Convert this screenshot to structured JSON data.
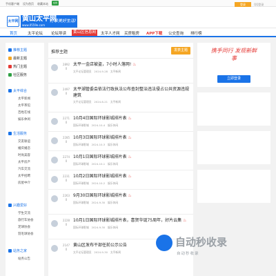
{
  "topbar": {
    "links": [
      "手机客户端",
      "设为首页",
      "收藏本站"
    ],
    "badge": "在线",
    "right": [
      "注册",
      "登录"
    ]
  },
  "header": {
    "logo_text": "太平网",
    "brand_title": "黄山太平网",
    "brand_url": "www.0559e.com",
    "slogan": "分享美好生活!",
    "login_button": "登录",
    "login_hint": "QQ登录"
  },
  "nav": {
    "items": [
      "首页",
      "太平论坛",
      "论坛导读",
      "黄山区信息网",
      "太平人才网",
      "买房租房",
      "APP下载",
      "公交查询",
      "排行榜"
    ]
  },
  "sidebar": {
    "top_items": [
      "推荐主题",
      "最新主题",
      "热门主题",
      "社区服务"
    ],
    "groups": [
      {
        "title": "太平综合",
        "subs": [
          "太平新闻",
          "太平茶馆",
          "百姓在线",
          "娱乐休闲"
        ]
      },
      {
        "title": "生活服务",
        "subs": [
          "交友联谊",
          "婚庆婚恋",
          "时尚美容",
          "太平房产",
          "汽车交流",
          "太平招聘",
          "房屋中介"
        ]
      },
      {
        "title": "兴趣爱好",
        "subs": [
          "学生交流",
          "旅行车协会",
          "足球协会",
          "羽毛球协会"
        ]
      },
      {
        "title": "站务之家",
        "subs": [
          "站务公告"
        ]
      }
    ]
  },
  "main": {
    "title": "推荐主题",
    "post_button": "发表主题",
    "posts": [
      {
        "views": "2892",
        "replies": "0",
        "title": "太平一金店被盗，7小时人落网!",
        "author": "太平论坛管理员",
        "date": "2024-9-28",
        "forum": "太平新闻"
      },
      {
        "views": "2497",
        "replies": "0",
        "title": "太平湖管委会依法行政执法公布查封整治违法侵占公共资源违规建筑",
        "author": "太平论坛管理员",
        "date": "2024-6-21",
        "forum": "太平新闻"
      },
      {
        "views": "2271",
        "replies": "0",
        "title": "10月4日国际环球影城排片表",
        "author": "国际环球影城",
        "date": "2024-10-4",
        "forum": "娱乐休闲"
      },
      {
        "views": "2285",
        "replies": "0",
        "title": "10月3日国际环球影城排片表",
        "author": "国际环球影城",
        "date": "2024-10-3",
        "forum": "娱乐休闲"
      },
      {
        "views": "2274",
        "replies": "0",
        "title": "10月1日国际环球影城排片表",
        "author": "国际环球影城",
        "date": "2024-10-1",
        "forum": "娱乐休闲"
      },
      {
        "views": "2231",
        "replies": "0",
        "title": "10月2日国际环球影城排片表",
        "author": "国际环球影城",
        "date": "2024-10-2",
        "forum": "娱乐休闲"
      },
      {
        "views": "2263",
        "replies": "0",
        "title": "9月30日国际环球影城排片表",
        "author": "国际环球影城",
        "date": "2024-9-30",
        "forum": "娱乐休闲"
      },
      {
        "views": "2228",
        "replies": "0",
        "title": "10月1日国际环球影城排片表，喜贺华诞75周年，好片云集",
        "author": "国际环球影城",
        "date": "2024-9-30",
        "forum": "娱乐休闲"
      },
      {
        "views": "2147",
        "replies": "0",
        "title": "黄山区发布干部任前公示公告",
        "author": "太平论坛管理员",
        "date": "2024-9-30",
        "forum": "太平新闻"
      }
    ]
  },
  "rightcol": {
    "art_text": "携手同行 发现新鲜事",
    "login_button": "立即登录"
  },
  "watermark": {
    "big": "自动秒收录",
    "sub": "自动秒收录"
  }
}
